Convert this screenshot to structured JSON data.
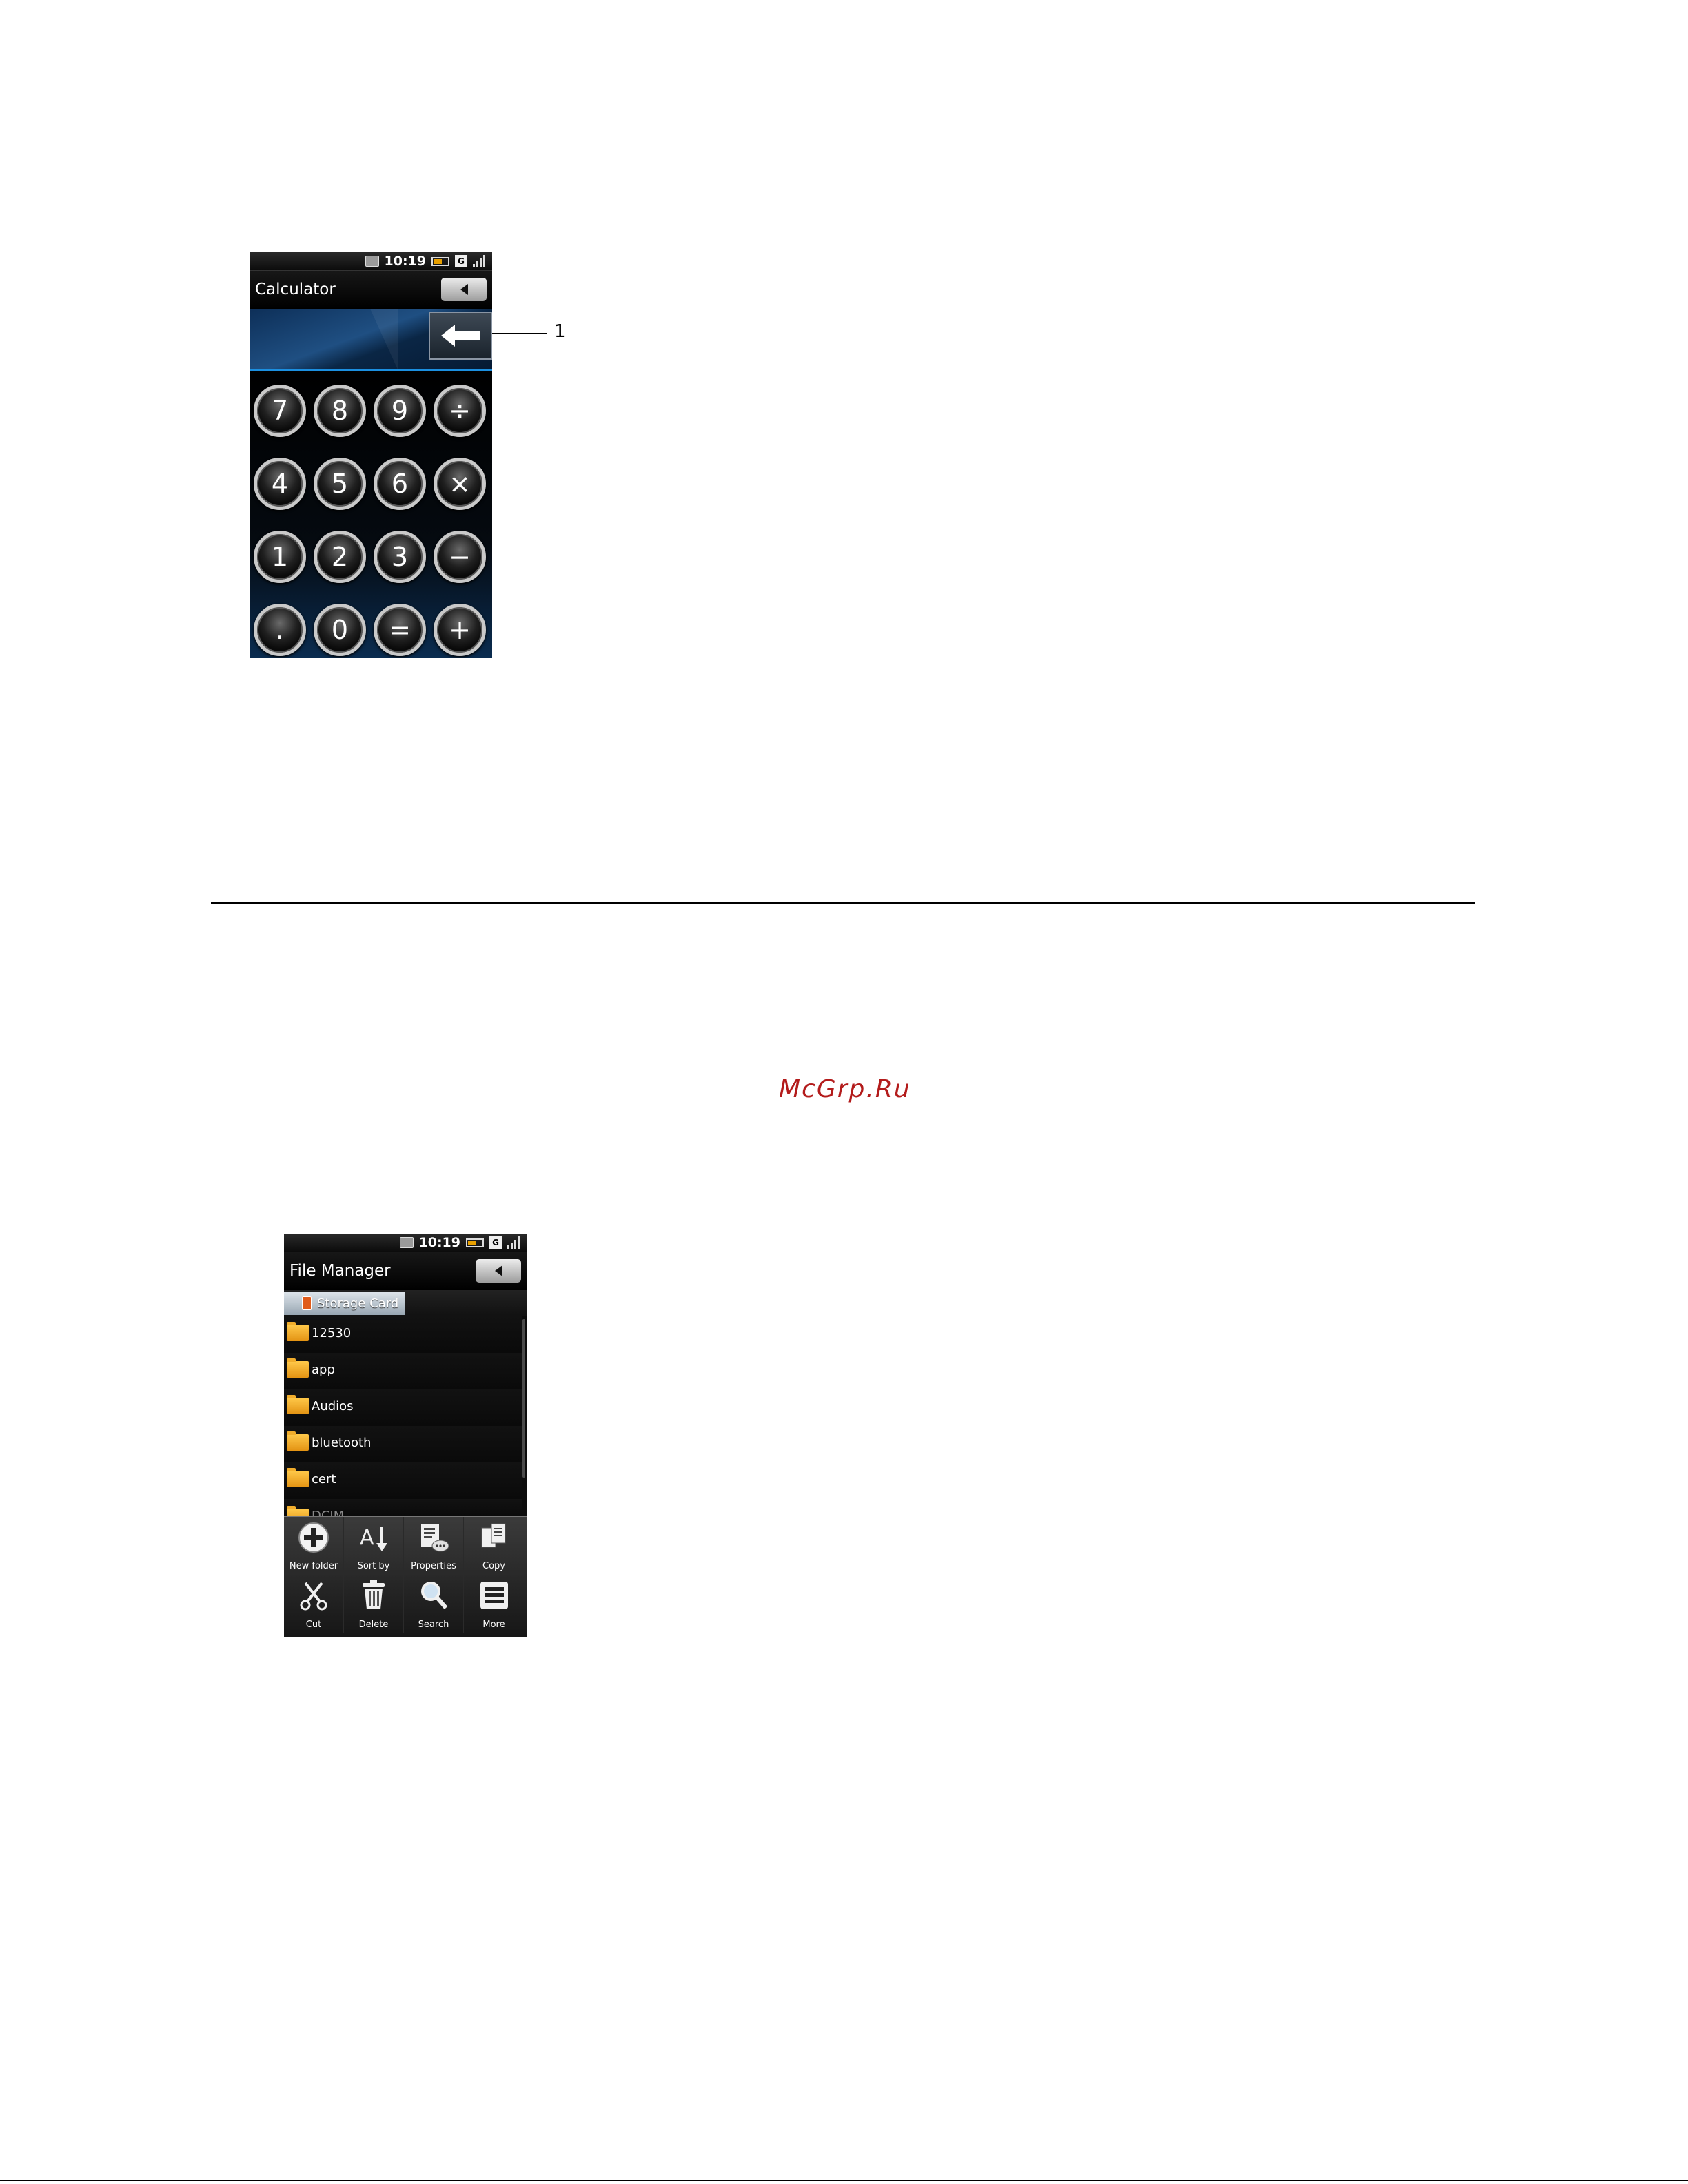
{
  "calculator": {
    "status_time": "10:19",
    "sim_label": "G",
    "title": "Calculator",
    "callout_number": "1",
    "keys": [
      "7",
      "8",
      "9",
      "÷",
      "4",
      "5",
      "6",
      "×",
      "1",
      "2",
      "3",
      "−",
      ".",
      "0",
      "=",
      "+"
    ]
  },
  "watermark": "McGrp.Ru",
  "file_manager": {
    "status_time": "10:19",
    "sim_label": "G",
    "title": "File Manager",
    "breadcrumb": "Storage Card",
    "folders": [
      "12530",
      "app",
      "Audios",
      "bluetooth",
      "cert",
      "DCIM"
    ],
    "menu": [
      "New folder",
      "Sort by",
      "Properties",
      "Copy",
      "Cut",
      "Delete",
      "Search",
      "More"
    ]
  }
}
